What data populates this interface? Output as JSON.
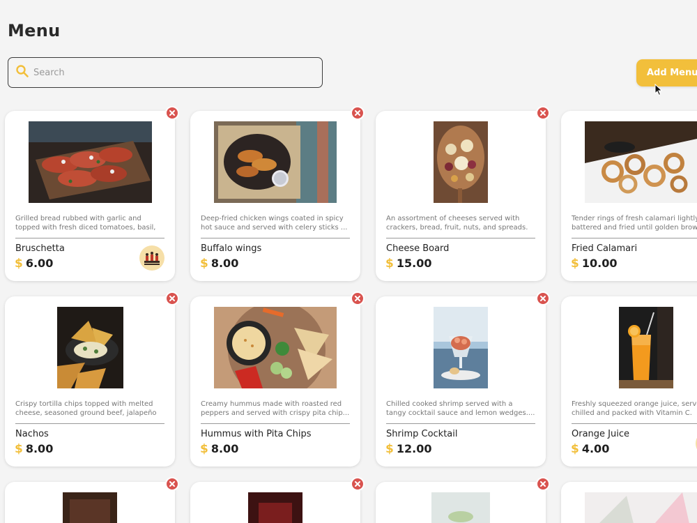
{
  "header": {
    "title": "Menu"
  },
  "search": {
    "placeholder": "Search",
    "value": ""
  },
  "actions": {
    "add_menu_label": "Add Menu"
  },
  "colors": {
    "accent": "#f2bf3b",
    "remove": "#d9534f",
    "background": "#f4f4f4"
  },
  "currency_symbol": "$",
  "items": [
    {
      "name": "Bruschetta",
      "price": "6.00",
      "description": "Grilled bread rubbed with garlic and\ntopped with fresh diced tomatoes, basil, ...",
      "image": "bruschetta"
    },
    {
      "name": "Buffalo wings",
      "price": "8.00",
      "description": "Deep-fried chicken wings coated in spicy\nhot sauce and served with celery sticks ...",
      "image": "buffalo-wings"
    },
    {
      "name": "Cheese Board",
      "price": "15.00",
      "description": "An assortment of cheeses served with\ncrackers, bread, fruit, nuts, and spreads. ...",
      "image": "cheese-board"
    },
    {
      "name": "Fried Calamari",
      "price": "10.00",
      "description": "Tender rings of fresh calamari lightly\nbattered and fried until golden brown",
      "image": "fried-calamari"
    },
    {
      "name": "Nachos",
      "price": "8.00",
      "description": "Crispy tortilla chips topped with melted\ncheese, seasoned ground beef, jalapeño ...",
      "image": "nachos"
    },
    {
      "name": "Hummus with Pita Chips",
      "price": "8.00",
      "description": "Creamy hummus made with roasted red\npeppers and served with crispy pita chip...",
      "image": "hummus"
    },
    {
      "name": "Shrimp Cocktail",
      "price": "12.00",
      "description": "Chilled cooked shrimp served with a\ntangy cocktail sauce and lemon wedges....",
      "image": "shrimp-cocktail"
    },
    {
      "name": "Orange Juice",
      "price": "4.00",
      "description": "Freshly squeezed orange juice, served\nchilled and packed with Vitamin C.",
      "image": "orange-juice"
    }
  ]
}
